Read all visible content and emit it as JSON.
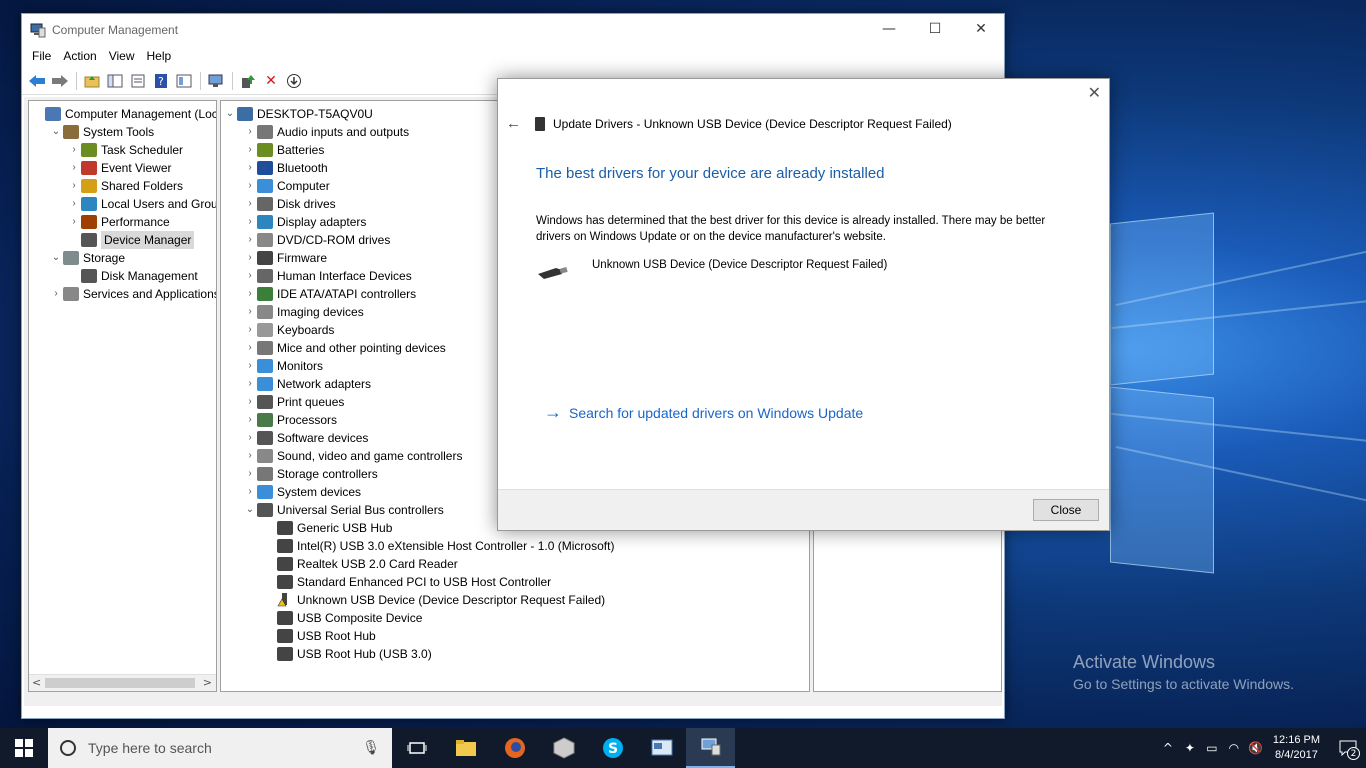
{
  "window": {
    "title": "Computer Management",
    "controls": {
      "minimize": "—",
      "maximize": "☐",
      "close": "✕"
    }
  },
  "menu": [
    "File",
    "Action",
    "Help",
    "View"
  ],
  "menu_order": [
    "File",
    "Action",
    "View",
    "Help"
  ],
  "left_tree": [
    {
      "label": "Computer Management (Local",
      "level": 0,
      "expanded": null
    },
    {
      "label": "System Tools",
      "level": 1,
      "expanded": true
    },
    {
      "label": "Task Scheduler",
      "level": 2,
      "expanded": false
    },
    {
      "label": "Event Viewer",
      "level": 2,
      "expanded": false
    },
    {
      "label": "Shared Folders",
      "level": 2,
      "expanded": false
    },
    {
      "label": "Local Users and Groups",
      "level": 2,
      "expanded": false
    },
    {
      "label": "Performance",
      "level": 2,
      "expanded": false
    },
    {
      "label": "Device Manager",
      "level": 2,
      "expanded": null,
      "selected": true
    },
    {
      "label": "Storage",
      "level": 1,
      "expanded": true
    },
    {
      "label": "Disk Management",
      "level": 2,
      "expanded": null
    },
    {
      "label": "Services and Applications",
      "level": 1,
      "expanded": false
    }
  ],
  "device_tree": {
    "root": "DESKTOP-T5AQV0U",
    "categories": [
      "Audio inputs and outputs",
      "Batteries",
      "Bluetooth",
      "Computer",
      "Disk drives",
      "Display adapters",
      "DVD/CD-ROM drives",
      "Firmware",
      "Human Interface Devices",
      "IDE ATA/ATAPI controllers",
      "Imaging devices",
      "Keyboards",
      "Mice and other pointing devices",
      "Monitors",
      "Network adapters",
      "Print queues",
      "Processors",
      "Software devices",
      "Sound, video and game controllers",
      "Storage controllers",
      "System devices",
      "Universal Serial Bus controllers"
    ],
    "usb_children": [
      "Generic USB Hub",
      "Intel(R) USB 3.0 eXtensible Host Controller - 1.0 (Microsoft)",
      "Realtek USB 2.0 Card Reader",
      "Standard Enhanced PCI to USB Host Controller",
      "Unknown USB Device (Device Descriptor Request Failed)",
      "USB Composite Device",
      "USB Root Hub",
      "USB Root Hub (USB 3.0)"
    ]
  },
  "dialog": {
    "header": "Update Drivers - Unknown USB Device (Device Descriptor Request Failed)",
    "heading": "The best drivers for your device are already installed",
    "body": "Windows has determined that the best driver for this device is already installed. There may be better drivers on Windows Update or on the device manufacturer's website.",
    "device_name": "Unknown USB Device (Device Descriptor Request Failed)",
    "link": "Search for updated drivers on Windows Update",
    "close_button": "Close"
  },
  "watermark": {
    "line1": "Activate Windows",
    "line2": "Go to Settings to activate Windows."
  },
  "taskbar": {
    "search_placeholder": "Type here to search",
    "time": "12:16 PM",
    "date": "8/4/2017",
    "notification_count": "2"
  }
}
